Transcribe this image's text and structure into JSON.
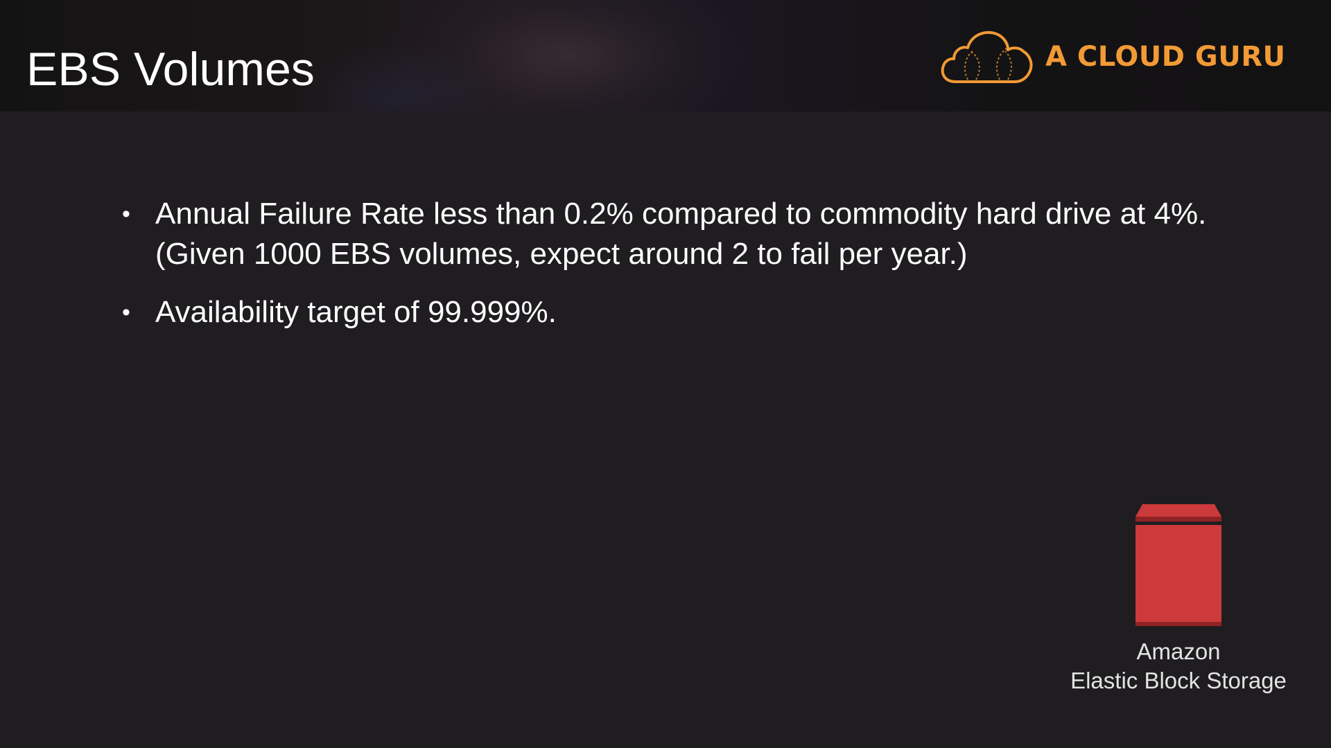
{
  "slide": {
    "title": "EBS Volumes",
    "brand": {
      "name": "A CLOUD GURU",
      "color": "#f29a35",
      "icon": "cloud-logo-icon"
    },
    "bullets": [
      "Annual Failure Rate less than 0.2% compared to commodity hard drive at 4%.  (Given 1000 EBS volumes, expect around 2 to fail per year.)",
      "Availability target of 99.999%."
    ],
    "service": {
      "icon": "ebs-volume-icon",
      "color": "#cd3a3b",
      "label_line1": "Amazon",
      "label_line2": "Elastic Block Storage"
    }
  }
}
